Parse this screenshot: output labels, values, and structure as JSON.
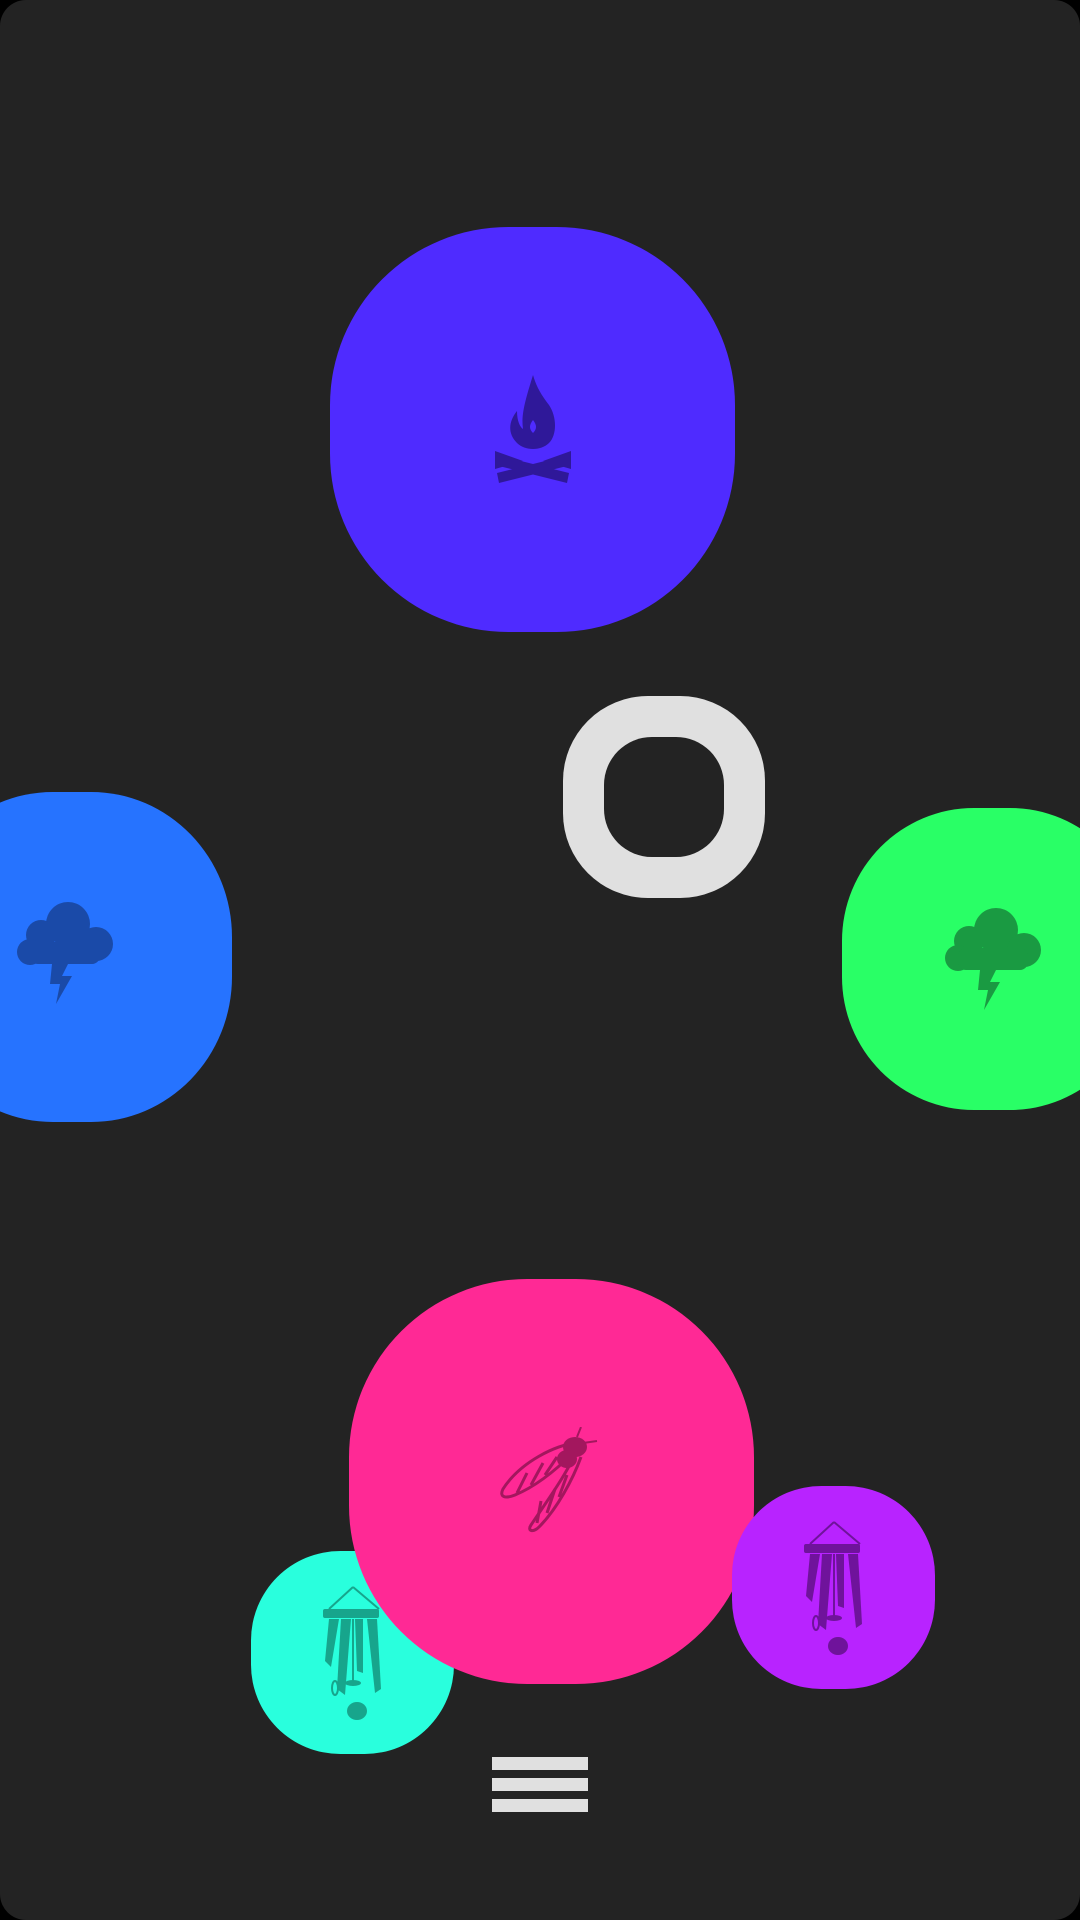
{
  "app": {
    "background": "#232323"
  },
  "sounds": [
    {
      "name": "campfire",
      "icon": "campfire-icon",
      "color": "#4f2bff",
      "icon_color": "#2f1899"
    },
    {
      "name": "thunderstorm",
      "icon": "storm-cloud-icon",
      "color": "#2673ff",
      "icon_color": "#1a4aa8"
    },
    {
      "name": "thunderstorm",
      "icon": "storm-cloud-icon",
      "color": "#29ff66",
      "icon_color": "#1a9a42"
    },
    {
      "name": "cicada",
      "icon": "cicada-icon",
      "color": "#ff2995",
      "icon_color": "#a3175e"
    },
    {
      "name": "wind-chimes",
      "icon": "wind-chimes-icon",
      "color": "#29ffdd",
      "icon_color": "#17a58c"
    },
    {
      "name": "wind-chimes",
      "icon": "wind-chimes-icon",
      "color": "#b823ff",
      "icon_color": "#6f139b"
    }
  ],
  "controls": {
    "center_button_icon": "ring-icon",
    "menu_icon": "hamburger-menu-icon",
    "accent": "#e0e0e0"
  }
}
